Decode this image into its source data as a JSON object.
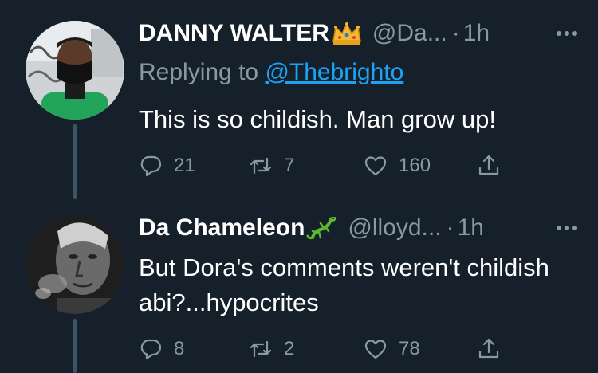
{
  "tweets": [
    {
      "display_name": "DANNY WALTER",
      "name_emoji": "crown-emoji",
      "handle": "@Da...",
      "dot": "·",
      "time": "1h",
      "replying_prefix": "Replying to ",
      "replying_to": "@Thebrighto",
      "text": "This is so childish. Man grow up!",
      "replies": "21",
      "retweets": "7",
      "likes": "160"
    },
    {
      "display_name": "Da Chameleon",
      "name_emoji": "lizard-emoji",
      "handle": "@lloyd...",
      "dot": "·",
      "time": "1h",
      "text": "But Dora's comments weren't childish abi?...hypocrites",
      "replies": "8",
      "retweets": "2",
      "likes": "78"
    }
  ],
  "colors": {
    "background": "#15202b",
    "secondary_text": "#8899a6",
    "link": "#1da1f2",
    "thread_line": "#3d5466"
  },
  "icons": [
    "reply-icon",
    "retweet-icon",
    "like-icon",
    "share-icon",
    "more-icon"
  ]
}
